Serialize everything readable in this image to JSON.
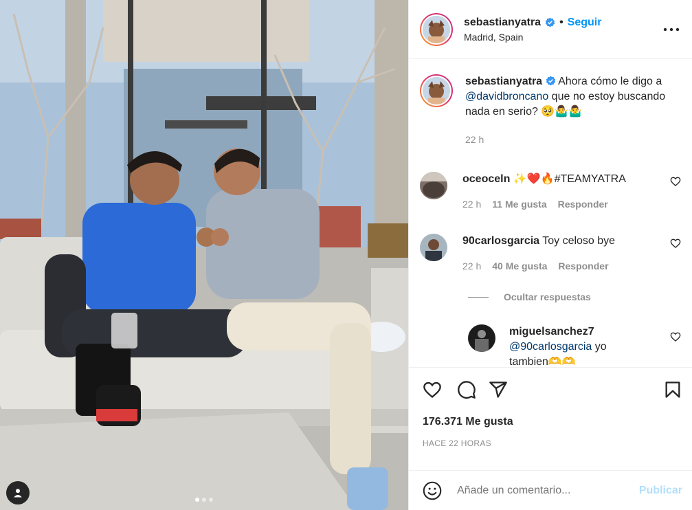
{
  "post": {
    "username": "sebastianyatra",
    "follow_label": "Seguir",
    "separator": "•",
    "location": "Madrid, Spain",
    "more_label": "•••",
    "caption": {
      "username": "sebastianyatra",
      "text_before": "Ahora cómo le digo a",
      "mention": "@davidbroncano",
      "text_after": "que no estoy buscando nada en serio? 🥺🤷‍♂️🤷‍♂️",
      "time": "22 h"
    },
    "comments": [
      {
        "username": "oceoceln",
        "text": "✨❤️🔥#TEAMYATRA",
        "time": "22 h",
        "likes": "11 Me gusta",
        "reply": "Responder"
      },
      {
        "username": "90carlosgarcia",
        "text": "Toy celoso bye",
        "time": "22 h",
        "likes": "40 Me gusta",
        "reply": "Responder"
      }
    ],
    "hide_replies_label": "Ocultar respuestas",
    "reply": {
      "username": "miguelsanchez7",
      "mention": "@90carlosgarcia",
      "text": "yo",
      "text2": "tambien🫶🫶"
    },
    "likes_total": "176.371 Me gusta",
    "timestamp": "HACE 22 HORAS",
    "add_comment_placeholder": "Añade un comentario...",
    "publish_label": "Publicar"
  },
  "carousel": {
    "count": 3,
    "active": 0
  },
  "colors": {
    "accent": "#0095f6",
    "verified": "#3897f0",
    "mention": "#00376b",
    "muted": "#8e8e8e"
  }
}
